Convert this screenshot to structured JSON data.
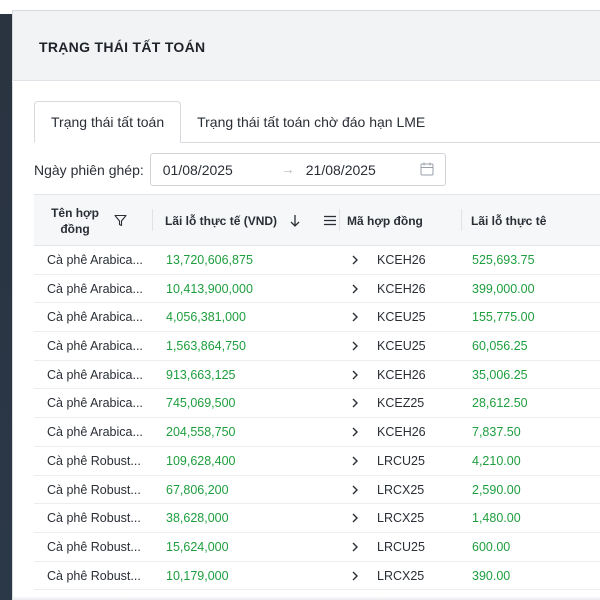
{
  "header": {
    "title": "TRẠNG THÁI TẤT TOÁN"
  },
  "tabs": [
    {
      "label": "Trạng thái tất toán",
      "active": true
    },
    {
      "label": "Trạng thái tất toán chờ đáo hạn LME",
      "active": false
    }
  ],
  "filter": {
    "label": "Ngày phiên ghép:",
    "start_date": "01/08/2025",
    "separator": "→",
    "end_date": "21/08/2025",
    "icon": "calendar-icon"
  },
  "table": {
    "columns": {
      "name": "Tên hợp đồng",
      "pnl_vnd": "Lãi lỗ thực tế (VND)",
      "code": "Mã hợp đồng",
      "pnl": "Lãi lỗ thực tê"
    },
    "rows": [
      {
        "name": "Cà phê Arabica...",
        "pnl_vnd": "13,720,606,875",
        "code": "KCEH26",
        "pnl": "525,693.75"
      },
      {
        "name": "Cà phê Arabica...",
        "pnl_vnd": "10,413,900,000",
        "code": "KCEH26",
        "pnl": "399,000.00"
      },
      {
        "name": "Cà phê Arabica...",
        "pnl_vnd": "4,056,381,000",
        "code": "KCEU25",
        "pnl": "155,775.00"
      },
      {
        "name": "Cà phê Arabica...",
        "pnl_vnd": "1,563,864,750",
        "code": "KCEU25",
        "pnl": "60,056.25"
      },
      {
        "name": "Cà phê Arabica...",
        "pnl_vnd": "913,663,125",
        "code": "KCEH26",
        "pnl": "35,006.25"
      },
      {
        "name": "Cà phê Arabica...",
        "pnl_vnd": "745,069,500",
        "code": "KCEZ25",
        "pnl": "28,612.50"
      },
      {
        "name": "Cà phê Arabica...",
        "pnl_vnd": "204,558,750",
        "code": "KCEH26",
        "pnl": "7,837.50"
      },
      {
        "name": "Cà phê Robust...",
        "pnl_vnd": "109,628,400",
        "code": "LRCU25",
        "pnl": "4,210.00"
      },
      {
        "name": "Cà phê Robust...",
        "pnl_vnd": "67,806,200",
        "code": "LRCX25",
        "pnl": "2,590.00"
      },
      {
        "name": "Cà phê Robust...",
        "pnl_vnd": "38,628,000",
        "code": "LRCX25",
        "pnl": "1,480.00"
      },
      {
        "name": "Cà phê Robust...",
        "pnl_vnd": "15,624,000",
        "code": "LRCU25",
        "pnl": "600.00"
      },
      {
        "name": "Cà phê Robust...",
        "pnl_vnd": "10,179,000",
        "code": "LRCX25",
        "pnl": "390.00"
      }
    ]
  },
  "colors": {
    "positive": "#1e9e3e",
    "header_bg": "#f2f3f5",
    "sidebar": "#2b3848"
  }
}
